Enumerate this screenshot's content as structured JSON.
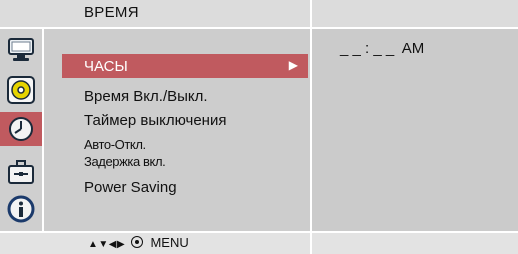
{
  "header": {
    "title": "ВРЕМЯ"
  },
  "sidebar": {
    "icons": [
      {
        "name": "monitor-icon"
      },
      {
        "name": "color-disc-icon"
      },
      {
        "name": "clock-icon",
        "active": true
      },
      {
        "name": "toolbox-icon"
      },
      {
        "name": "info-icon"
      }
    ]
  },
  "menu": {
    "items": [
      {
        "label": "ЧАСЫ",
        "selected": true,
        "arrow": "▶"
      },
      {
        "label": "Время Вкл./Выкл."
      },
      {
        "label": "Таймер выключения"
      },
      {
        "label": "Авто-Откл."
      },
      {
        "label": "Задержка вкл."
      },
      {
        "label": "Power Saving"
      }
    ]
  },
  "detail": {
    "clock_value": "_ _ : _ _  AM"
  },
  "footer": {
    "arrows": "▲▼◀▶",
    "menu_label": "MENU"
  },
  "colors": {
    "accent": "#c05a5f",
    "panel": "#cdcdcd",
    "bar": "#dcdcdc"
  }
}
